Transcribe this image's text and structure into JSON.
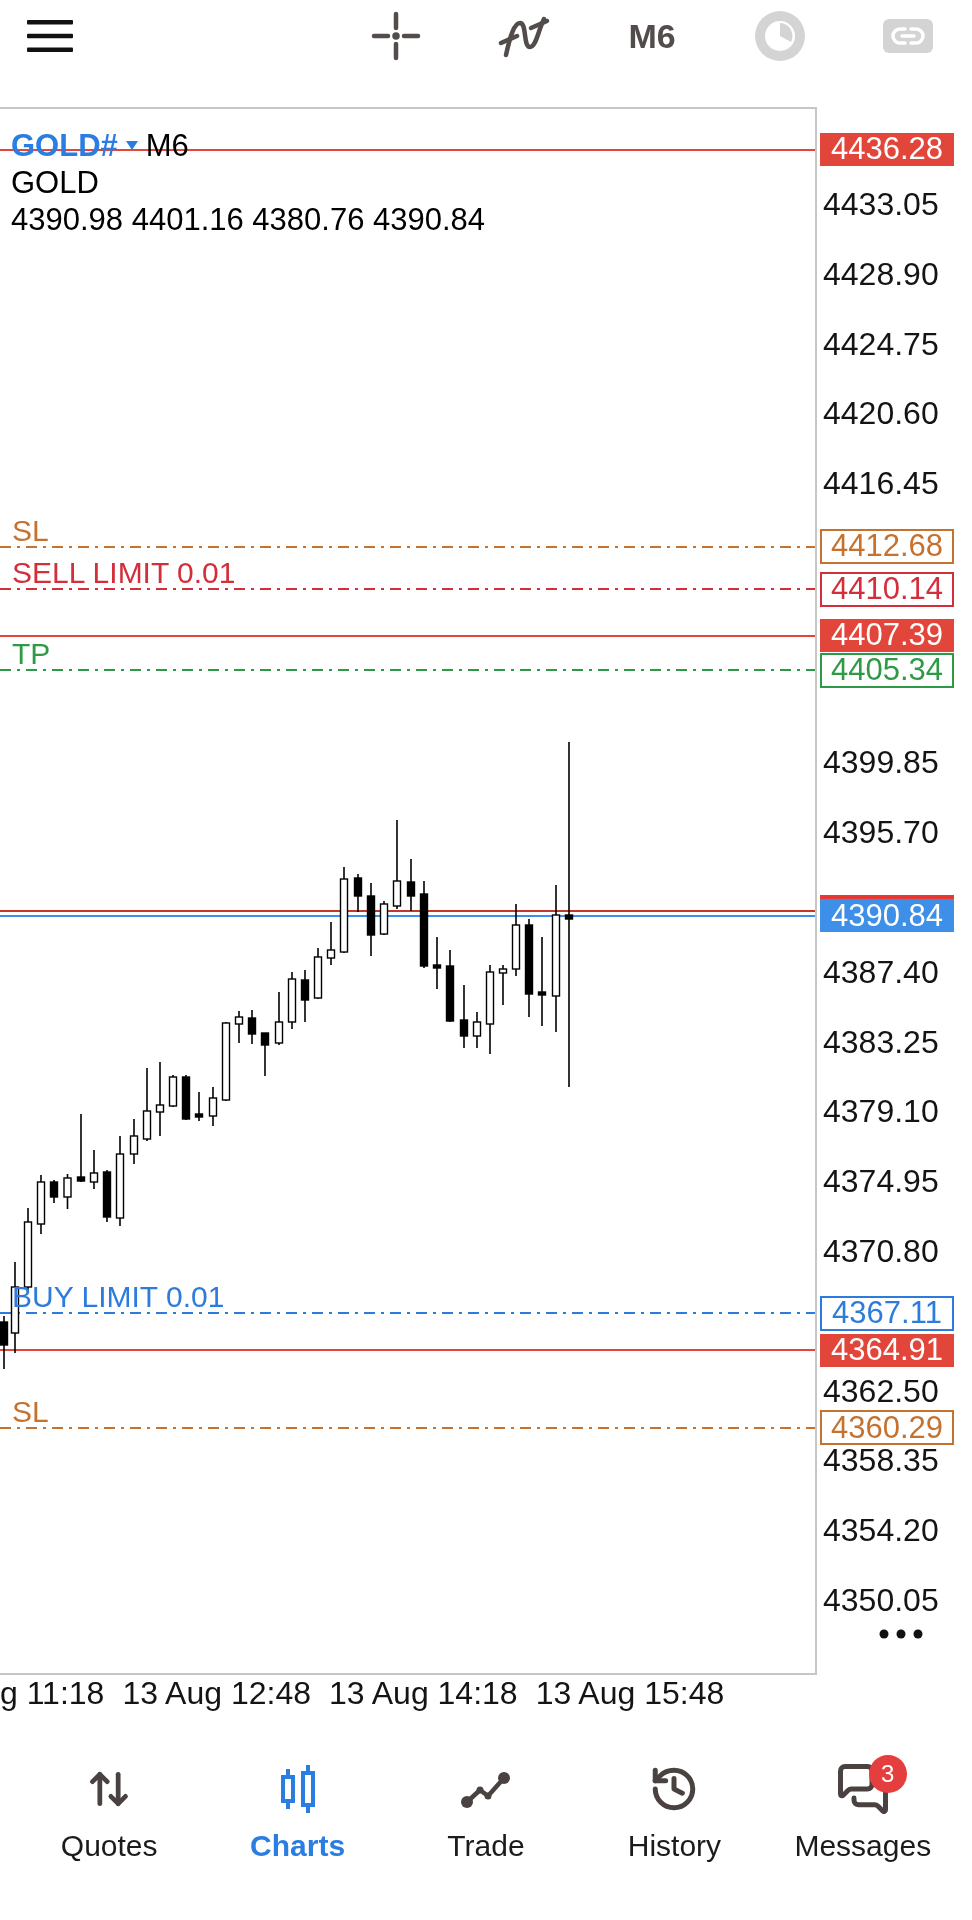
{
  "toolbar": {
    "buttons": [
      {
        "kind": "icon",
        "disabled": false
      },
      {
        "kind": "icon",
        "disabled": false
      },
      {
        "kind": "text",
        "label": "M6",
        "disabled": false
      },
      {
        "kind": "icon",
        "disabled": true
      },
      {
        "kind": "icon",
        "disabled": true
      }
    ]
  },
  "chart": {
    "symbol": "GOLD#",
    "timeframe": "M6",
    "description": "GOLD",
    "ohlc": "4390.98 4401.16 4380.76 4390.84",
    "levels": [
      {
        "kind": "line",
        "price": "4436.28",
        "color": "#e2463b"
      },
      {
        "kind": "order",
        "label": "SL",
        "price": "4412.68",
        "color": "#c5722f"
      },
      {
        "kind": "order",
        "label": "SELL LIMIT 0.01",
        "price": "4410.14",
        "color": "#d22f3a"
      },
      {
        "kind": "line",
        "price": "4407.39",
        "color": "#e2463b"
      },
      {
        "kind": "order",
        "label": "TP",
        "price": "4405.34",
        "color": "#2e9a45"
      },
      {
        "kind": "bid",
        "price": "4390.84",
        "color": "#3d8fe8"
      },
      {
        "kind": "order",
        "label": "BUY LIMIT 0.01",
        "price": "4367.11",
        "color": "#2d7bdc"
      },
      {
        "kind": "line",
        "price": "4364.91",
        "color": "#e2463b"
      },
      {
        "kind": "order",
        "label": "SL",
        "price": "4360.29",
        "color": "#c5722f"
      }
    ],
    "price_ticks": [
      "4433.05",
      "4428.90",
      "4424.75",
      "4420.60",
      "4416.45",
      "4399.85",
      "4395.70",
      "4387.40",
      "4383.25",
      "4379.10",
      "4374.95",
      "4370.80",
      "4362.50",
      "4358.35",
      "4354.20",
      "4350.05"
    ],
    "time_ticks": [
      "g 11:18",
      "13 Aug 12:48",
      "13 Aug 14:18",
      "13 Aug 15:48"
    ]
  },
  "bottom_nav": [
    {
      "label": "Quotes",
      "selected": false
    },
    {
      "label": "Charts",
      "selected": true
    },
    {
      "label": "Trade",
      "selected": false
    },
    {
      "label": "History",
      "selected": false
    },
    {
      "label": "Messages",
      "selected": false,
      "badge": "3"
    }
  ]
}
